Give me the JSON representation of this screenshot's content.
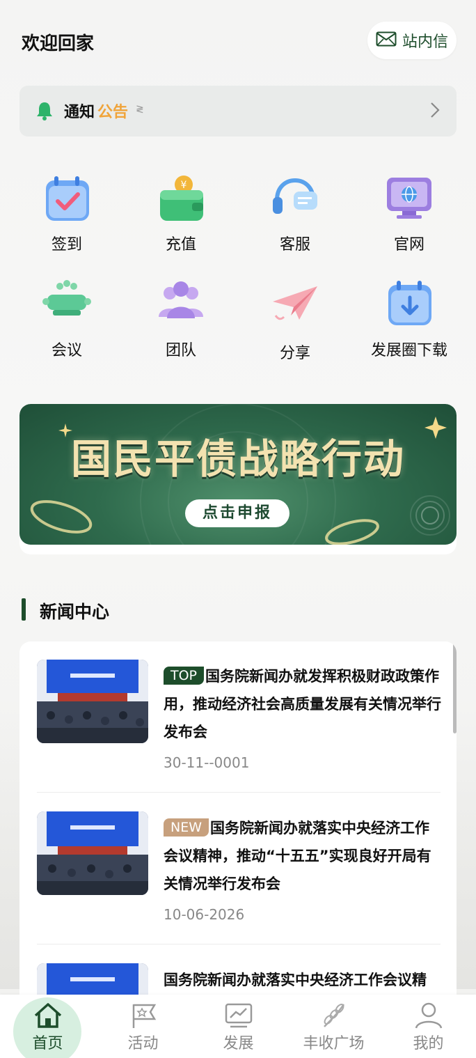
{
  "header": {
    "welcome": "欢迎回家",
    "inbox_label": "站内信"
  },
  "notice": {
    "title_part1": "通知",
    "title_part2": "公告",
    "deco": "≷"
  },
  "grid": {
    "items": [
      {
        "label": "签到",
        "icon": "calendar-check-icon"
      },
      {
        "label": "充值",
        "icon": "wallet-coin-icon"
      },
      {
        "label": "客服",
        "icon": "headset-icon"
      },
      {
        "label": "官网",
        "icon": "monitor-globe-icon"
      },
      {
        "label": "会议",
        "icon": "meeting-table-icon"
      },
      {
        "label": "团队",
        "icon": "team-icon"
      },
      {
        "label": "分享",
        "icon": "paper-plane-icon"
      },
      {
        "label": "发展圈下载",
        "icon": "calendar-download-icon"
      }
    ]
  },
  "banner": {
    "title": "国民平债战略行动",
    "button": "点击申报"
  },
  "news": {
    "section_title": "新闻中心",
    "items": [
      {
        "tag": "TOP",
        "title": "国务院新闻办就发挥积极财政政策作用，推动经济社会高质量发展有关情况举行发布会",
        "date": "30-11--0001"
      },
      {
        "tag": "NEW",
        "title": "国务院新闻办就落实中央经济工作会议精神，推动“十五五”实现良好开局有关情况举行发布会",
        "date": "10-06-2026"
      },
      {
        "tag": "",
        "title": "国务院新闻办就落实中央经济工作会议精",
        "date": ""
      }
    ]
  },
  "tabbar": {
    "tabs": [
      {
        "label": "首页",
        "icon": "home-icon"
      },
      {
        "label": "活动",
        "icon": "flag-star-icon"
      },
      {
        "label": "发展",
        "icon": "chart-trend-icon"
      },
      {
        "label": "丰收广场",
        "icon": "wheat-icon"
      },
      {
        "label": "我的",
        "icon": "user-icon"
      }
    ]
  },
  "colors": {
    "brand_green": "#1d4d2b",
    "accent_orange": "#f0a43a",
    "tag_new": "#c7a07d"
  }
}
